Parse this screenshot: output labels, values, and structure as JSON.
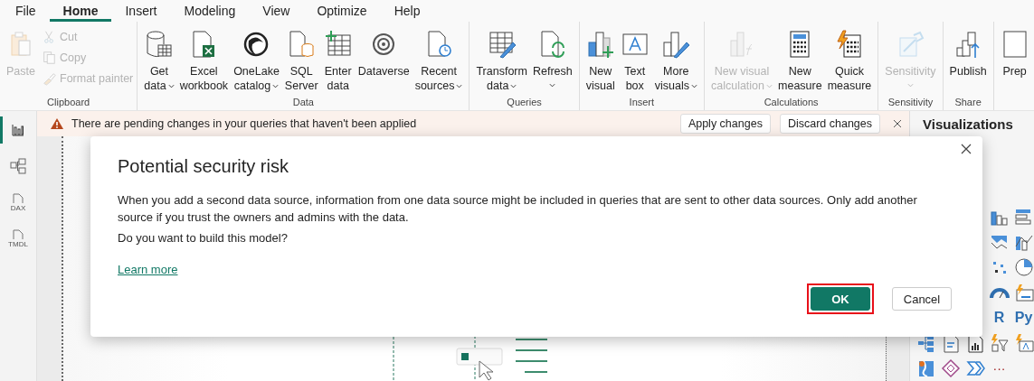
{
  "menu": [
    {
      "label": "File",
      "selected": false
    },
    {
      "label": "Home",
      "selected": true
    },
    {
      "label": "Insert",
      "selected": false
    },
    {
      "label": "Modeling",
      "selected": false
    },
    {
      "label": "View",
      "selected": false
    },
    {
      "label": "Optimize",
      "selected": false
    },
    {
      "label": "Help",
      "selected": false
    }
  ],
  "ribbon": [
    {
      "name": "Clipboard",
      "items": [
        {
          "kind": "large",
          "lines": [
            "Paste"
          ],
          "disabled": true,
          "dropdown": false
        },
        {
          "kind": "small",
          "lines": [
            "Cut"
          ],
          "disabled": true
        },
        {
          "kind": "small",
          "lines": [
            "Copy"
          ],
          "disabled": true
        },
        {
          "kind": "small",
          "lines": [
            "Format painter"
          ],
          "disabled": true
        }
      ]
    },
    {
      "name": "Data",
      "items": [
        {
          "kind": "large",
          "lines": [
            "Get",
            "data"
          ],
          "disabled": false,
          "dropdown": true
        },
        {
          "kind": "large",
          "lines": [
            "Excel",
            "workbook"
          ],
          "disabled": false,
          "dropdown": false
        },
        {
          "kind": "large",
          "lines": [
            "OneLake",
            "catalog"
          ],
          "disabled": false,
          "dropdown": true
        },
        {
          "kind": "large",
          "lines": [
            "SQL",
            "Server"
          ],
          "disabled": false,
          "dropdown": false
        },
        {
          "kind": "large",
          "lines": [
            "Enter",
            "data"
          ],
          "disabled": false,
          "dropdown": false
        },
        {
          "kind": "large",
          "lines": [
            "Dataverse"
          ],
          "disabled": false,
          "dropdown": false
        },
        {
          "kind": "large",
          "lines": [
            "Recent",
            "sources"
          ],
          "disabled": false,
          "dropdown": true
        }
      ]
    },
    {
      "name": "Queries",
      "items": [
        {
          "kind": "large",
          "lines": [
            "Transform",
            "data"
          ],
          "disabled": false,
          "dropdown": true
        },
        {
          "kind": "large",
          "lines": [
            "Refresh"
          ],
          "disabled": false,
          "dropdown": true
        }
      ]
    },
    {
      "name": "Insert",
      "items": [
        {
          "kind": "large",
          "lines": [
            "New",
            "visual"
          ],
          "disabled": false,
          "dropdown": false
        },
        {
          "kind": "large",
          "lines": [
            "Text",
            "box"
          ],
          "disabled": false,
          "dropdown": false
        },
        {
          "kind": "large",
          "lines": [
            "More",
            "visuals"
          ],
          "disabled": false,
          "dropdown": true
        }
      ]
    },
    {
      "name": "Calculations",
      "items": [
        {
          "kind": "large",
          "lines": [
            "New visual",
            "calculation"
          ],
          "disabled": true,
          "dropdown": true
        },
        {
          "kind": "large",
          "lines": [
            "New",
            "measure"
          ],
          "disabled": false,
          "dropdown": false
        },
        {
          "kind": "large",
          "lines": [
            "Quick",
            "measure"
          ],
          "disabled": false,
          "dropdown": false
        }
      ]
    },
    {
      "name": "Sensitivity",
      "items": [
        {
          "kind": "large",
          "lines": [
            "Sensitivity"
          ],
          "disabled": true,
          "dropdown": true
        }
      ]
    },
    {
      "name": "Share",
      "items": [
        {
          "kind": "large",
          "lines": [
            "Publish"
          ],
          "disabled": false,
          "dropdown": false
        }
      ]
    },
    {
      "items": [
        {
          "kind": "large",
          "lines": [
            "Prep"
          ],
          "disabled": false,
          "dropdown": false
        }
      ]
    }
  ],
  "view_rail": [
    {
      "selected": true
    },
    {
      "selected": false
    },
    {
      "selected": false,
      "label": "DAX"
    },
    {
      "selected": false,
      "label": "TMDL"
    }
  ],
  "notification": {
    "message": "There are pending changes in your queries that haven't been applied",
    "buttons": [
      "Apply changes",
      "Discard changes"
    ]
  },
  "visualizations": {
    "title": "Visualizations",
    "labels": [
      "R",
      "Py"
    ],
    "more": "···"
  },
  "dialog": {
    "title": "Potential security risk",
    "paragraphs": [
      "When you add a second data source, information from one data source might be included in queries that are sent to other data sources. Only add another source if you trust the owners and admins with the data.",
      "Do you want to build this model?"
    ],
    "link": "Learn more",
    "buttons": [
      {
        "label": "OK",
        "primary": true,
        "highlighted": true
      },
      {
        "label": "Cancel",
        "primary": false,
        "highlighted": false
      }
    ]
  }
}
